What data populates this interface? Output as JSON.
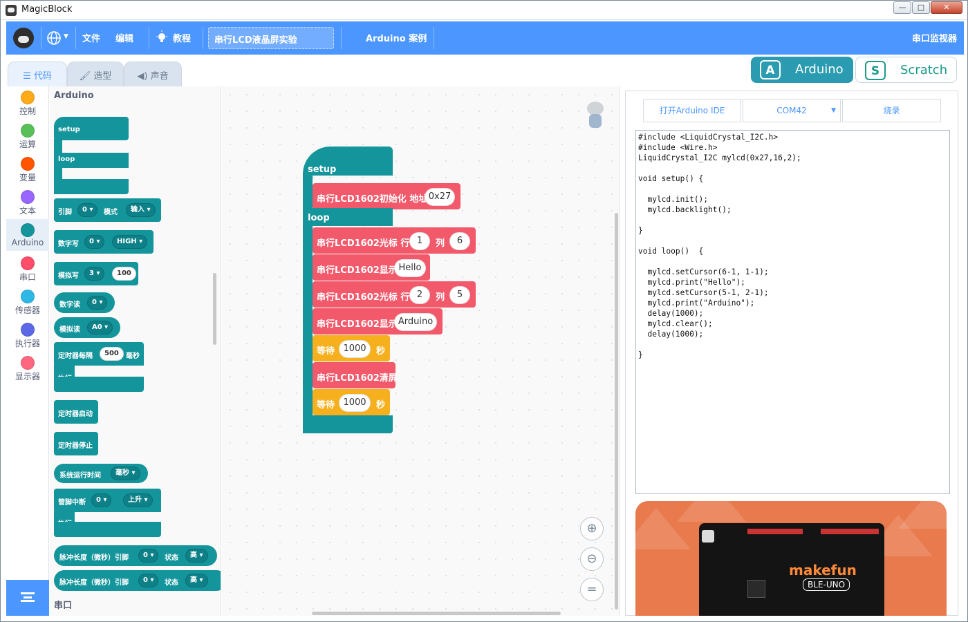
{
  "window": {
    "title": "MagicBlock",
    "min": "—",
    "max": "□",
    "close": "✕"
  },
  "menu": {
    "file": "文件",
    "edit": "编辑",
    "tutorial": "教程",
    "project_name": "串行LCD液晶屏实验",
    "examples": "Arduino 案例",
    "serial_monitor": "串口监视器"
  },
  "tabs": {
    "code": "代码",
    "costume": "造型",
    "sound": "声音"
  },
  "mode": {
    "arduino": "Arduino",
    "scratch": "Scratch",
    "arduino_icon": "A",
    "scratch_icon": "S"
  },
  "categories": [
    {
      "label": "控制",
      "color": "#ffab19"
    },
    {
      "label": "运算",
      "color": "#59c059"
    },
    {
      "label": "变量",
      "color": "#ff5500"
    },
    {
      "label": "文本",
      "color": "#9966ff"
    },
    {
      "label": "Arduino",
      "color": "#14949b",
      "selected": true
    },
    {
      "label": "串口",
      "color": "#ff4d6a"
    },
    {
      "label": "传感器",
      "color": "#2eb8e6"
    },
    {
      "label": "执行器",
      "color": "#5c68e6"
    },
    {
      "label": "显示器",
      "color": "#ff6680"
    }
  ],
  "palette": {
    "title": "Arduino",
    "setup": "setup",
    "loop": "loop",
    "pin": "引脚",
    "pin_val": "0",
    "mode": "模式",
    "mode_val": "输入",
    "digital_write": "数字写",
    "dw_pin": "0",
    "dw_val": "HIGH",
    "analog_write": "模拟写",
    "aw_pin": "3",
    "aw_val": "100",
    "digital_read": "数字读",
    "dr_pin": "0",
    "analog_read": "模拟读",
    "ar_pin": "A0",
    "timer_every": "定时器每隔",
    "timer_ms": "500",
    "ms": "毫秒",
    "exec": "执行",
    "timer_start": "定时器启动",
    "timer_stop": "定时器停止",
    "runtime": "系统运行时间",
    "runtime_unit": "毫秒",
    "pin_interrupt": "管脚中断",
    "pi_pin": "0",
    "pi_edge": "上升",
    "exec2": "执行",
    "pulse": "脉冲长度（微秒）引脚",
    "pulse_pin": "0",
    "state": "状态",
    "state_val": "高",
    "pulse2": "脉冲长度（微秒）引脚",
    "pulse2_pin": "0",
    "state2": "状态",
    "state2_val": "高",
    "section_serial": "串口"
  },
  "workspace": {
    "setup": "setup",
    "loop": "loop",
    "init": "串行LCD1602初始化 地址",
    "init_addr": "0x27",
    "cursor1": "串行LCD1602光标  行",
    "cursor1_row": "1",
    "col_lbl1": "列",
    "cursor1_col": "6",
    "show1": "串行LCD1602显示",
    "show1_val": "Hello",
    "cursor2": "串行LCD1602光标  行",
    "cursor2_row": "2",
    "col_lbl2": "列",
    "cursor2_col": "5",
    "show2": "串行LCD1602显示",
    "show2_val": "Arduino",
    "wait1": "等待",
    "wait1_val": "1000",
    "sec1": "秒",
    "clear": "串行LCD1602清屏",
    "wait2": "等待",
    "wait2_val": "1000",
    "sec2": "秒"
  },
  "panel": {
    "open_ide": "打开Arduino IDE",
    "port": "COM42",
    "upload": "烧录",
    "code": "#include <LiquidCrystal_I2C.h>\n#include <Wire.h>\nLiquidCrystal_I2C mylcd(0x27,16,2);\n\nvoid setup() {\n\n  mylcd.init();\n  mylcd.backlight();\n\n}\n\nvoid loop()  {\n\n  mylcd.setCursor(6-1, 1-1);\n  mylcd.print(\"Hello\");\n  mylcd.setCursor(5-1, 2-1);\n  mylcd.print(\"Arduino\");\n  delay(1000);\n  mylcd.clear();\n  delay(1000);\n\n}",
    "board_brand": "makefun",
    "board_model": "BLE-UNO"
  }
}
